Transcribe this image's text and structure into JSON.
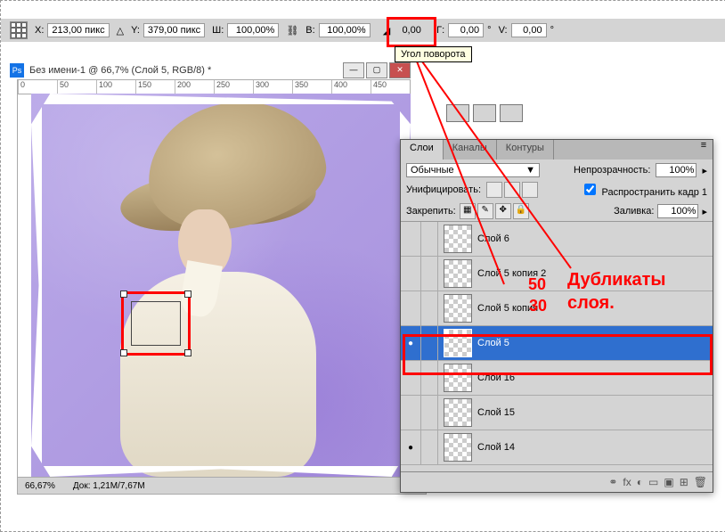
{
  "optbar": {
    "x_label": "X:",
    "x": "213,00 пикс",
    "tri": "△",
    "y_label": "Y:",
    "y": "379,00 пикс",
    "w_label": "Ш:",
    "w": "100,00%",
    "link": "⛓",
    "h_label": "В:",
    "h": "100,00%",
    "rot_icon": "◢",
    "rot": "0,00",
    "g_label": "Г:",
    "g": "0,00",
    "deg": "°",
    "v_label": "V:",
    "v": "0,00"
  },
  "tooltip": "Угол поворота",
  "doc": {
    "title": "Без имени-1 @ 66,7% (Слой 5, RGB/8) *",
    "min": "—",
    "max": "▢",
    "close": "✕"
  },
  "ruler": [
    "0",
    "50",
    "100",
    "150",
    "200",
    "250",
    "300",
    "350",
    "400",
    "450"
  ],
  "status": {
    "zoom": "66,67%",
    "doc": "Док: 1,21M/7,67M"
  },
  "tabs": {
    "layers": "Слои",
    "channels": "Каналы",
    "paths": "Контуры"
  },
  "blend": {
    "mode": "Обычные",
    "arrow": "▼",
    "opacity_label": "Непрозрачность:",
    "opacity": "100%",
    "arrow2": "▸"
  },
  "unify": {
    "label": "Унифицировать:",
    "propagate": "Распространить кадр 1"
  },
  "lock": {
    "label": "Закрепить:",
    "i1": "▦",
    "i2": "✎",
    "i3": "✥",
    "i4": "🔒",
    "fill_label": "Заливка:",
    "fill": "100%",
    "arrow": "▸"
  },
  "layers": [
    {
      "name": "Слой 6",
      "eye": false
    },
    {
      "name": "Слой 5 копия 2",
      "eye": false
    },
    {
      "name": "Слой 5 копия",
      "eye": false
    },
    {
      "name": "Слой 5",
      "eye": true,
      "sel": true
    },
    {
      "name": "Слой 16",
      "eye": false
    },
    {
      "name": "Слой 15",
      "eye": false
    },
    {
      "name": "Слой 14",
      "eye": true
    }
  ],
  "foot": {
    "i1": "⚭",
    "i2": "fx",
    "i3": "◐",
    "i4": "▭",
    "i5": "▣",
    "i6": "⊞",
    "i7": "🗑"
  },
  "annot": {
    "n50": "50",
    "n30": "30",
    "dub": "Дубликаты",
    "sloy": "слоя."
  }
}
